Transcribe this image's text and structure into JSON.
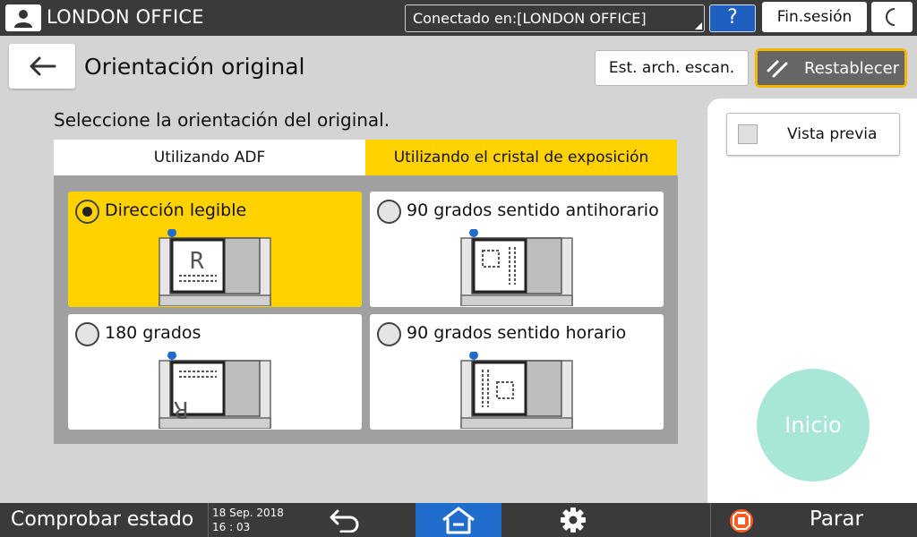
{
  "topbar": {
    "office_name": "LONDON OFFICE",
    "connected_label": "Conectado en:[LONDON OFFICE]",
    "help_label": "?",
    "logout_label": "Fin.sesión",
    "icons": {
      "user": "user-icon",
      "moon": "moon-icon"
    }
  },
  "header": {
    "title": "Orientación original",
    "scan_settings_label": "Est. arch. escan.",
    "reset_label": "Restablecer"
  },
  "main": {
    "instruction": "Seleccione la orientación del original.",
    "tabs": [
      {
        "label": "Utilizando ADF",
        "selected": false
      },
      {
        "label": "Utilizando el cristal de exposición",
        "selected": true
      }
    ],
    "options": [
      {
        "label": "Dirección legible",
        "selected": true
      },
      {
        "label": "90 grados sentido antihorario",
        "selected": false
      },
      {
        "label": "180 grados",
        "selected": false
      },
      {
        "label": "90 grados sentido horario",
        "selected": false
      }
    ]
  },
  "right_panel": {
    "preview_label": "Vista previa",
    "start_label": "Inicio"
  },
  "bottombar": {
    "status_label": "Comprobar estado",
    "date": "18 Sep. 2018",
    "time": "16 : 03",
    "stop_label": "Parar"
  },
  "colors": {
    "accent_yellow": "#ffd200",
    "topbar": "#3a3a3a",
    "home_blue": "#1f6ccc",
    "start_green": "#a8e6d8",
    "stop_orange": "#ff5a1f"
  }
}
